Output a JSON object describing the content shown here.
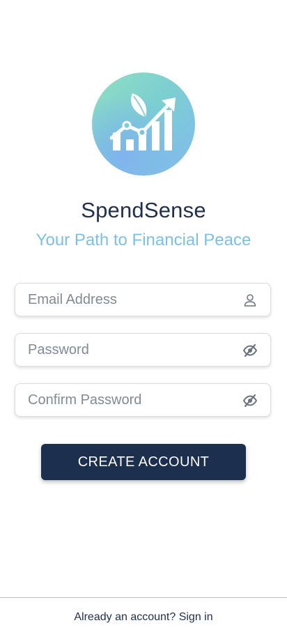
{
  "app": {
    "name": "SpendSense",
    "tagline": "Your Path to Financial Peace"
  },
  "logo": {
    "icon": "leaf-growth-chart-icon",
    "gradient_start": "#8fe0c2",
    "gradient_end": "#82b9ef"
  },
  "form": {
    "email": {
      "placeholder": "Email Address",
      "value": "",
      "icon": "user-icon"
    },
    "password": {
      "placeholder": "Password",
      "value": "",
      "icon": "eye-off-icon"
    },
    "confirm_password": {
      "placeholder": "Confirm Password",
      "value": "",
      "icon": "eye-off-icon"
    },
    "submit_label": "CREATE ACCOUNT"
  },
  "footer": {
    "signin_text": "Already an account? Sign in"
  },
  "colors": {
    "primary": "#1d2f4f",
    "accent": "#7cc0e2",
    "divider": "#8fcde6"
  }
}
